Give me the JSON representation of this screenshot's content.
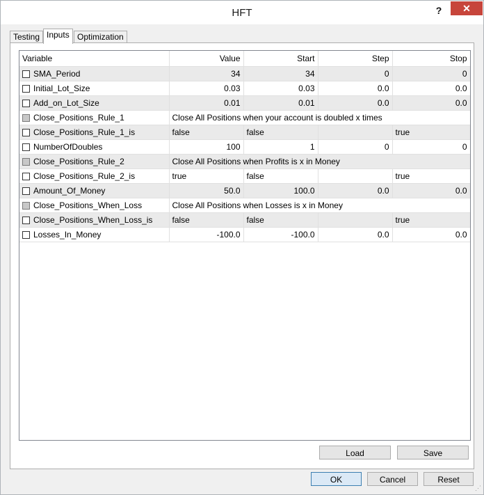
{
  "window": {
    "title": "HFT",
    "help_label": "?",
    "close_label": "✕"
  },
  "tabs": [
    {
      "label": "Testing",
      "active": false
    },
    {
      "label": "Inputs",
      "active": true
    },
    {
      "label": "Optimization",
      "active": false
    }
  ],
  "table": {
    "headers": {
      "variable": "Variable",
      "value": "Value",
      "start": "Start",
      "step": "Step",
      "stop": "Stop"
    },
    "rows": [
      {
        "kind": "num",
        "var": "SMA_Period",
        "value": "34",
        "start": "34",
        "step": "0",
        "stop": "0",
        "shade": true,
        "check": "empty"
      },
      {
        "kind": "num",
        "var": "Initial_Lot_Size",
        "value": "0.03",
        "start": "0.03",
        "step": "0.0",
        "stop": "0.0",
        "shade": false,
        "check": "empty"
      },
      {
        "kind": "num",
        "var": "Add_on_Lot_Size",
        "value": "0.01",
        "start": "0.01",
        "step": "0.0",
        "stop": "0.0",
        "shade": true,
        "check": "empty"
      },
      {
        "kind": "span",
        "var": "Close_Positions_Rule_1",
        "value": "Close All Positions when your account is doubled x times",
        "shade": false,
        "check": "grey"
      },
      {
        "kind": "bool",
        "var": "Close_Positions_Rule_1_is",
        "value": "false",
        "start": "false",
        "step": "",
        "stop": "true",
        "shade": true,
        "check": "empty"
      },
      {
        "kind": "num",
        "var": "NumberOfDoubles",
        "value": "100",
        "start": "1",
        "step": "0",
        "stop": "0",
        "shade": false,
        "check": "empty"
      },
      {
        "kind": "span",
        "var": "Close_Positions_Rule_2",
        "value": "Close All Positions when Profits is x in Money",
        "shade": true,
        "check": "grey"
      },
      {
        "kind": "bool",
        "var": "Close_Positions_Rule_2_is",
        "value": "true",
        "start": "false",
        "step": "",
        "stop": "true",
        "shade": false,
        "check": "empty"
      },
      {
        "kind": "num",
        "var": "Amount_Of_Money",
        "value": "50.0",
        "start": "100.0",
        "step": "0.0",
        "stop": "0.0",
        "shade": true,
        "check": "empty"
      },
      {
        "kind": "span",
        "var": "Close_Positions_When_Loss",
        "value": "Close All Positions when Losses is x in Money",
        "shade": false,
        "check": "grey"
      },
      {
        "kind": "bool",
        "var": "Close_Positions_When_Loss_is",
        "value": "false",
        "start": "false",
        "step": "",
        "stop": "true",
        "shade": true,
        "check": "empty"
      },
      {
        "kind": "num",
        "var": "Losses_In_Money",
        "value": "-100.0",
        "start": "-100.0",
        "step": "0.0",
        "stop": "0.0",
        "shade": false,
        "check": "empty"
      }
    ]
  },
  "buttons": {
    "load": "Load",
    "save": "Save",
    "ok": "OK",
    "cancel": "Cancel",
    "reset": "Reset"
  }
}
